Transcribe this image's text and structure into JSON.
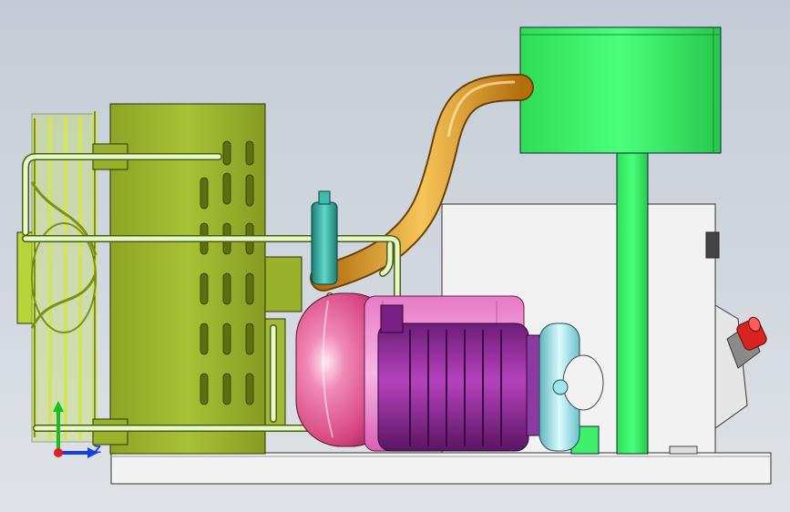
{
  "viewport": {
    "background_top": "#c3ccd6",
    "background_bottom": "#dfe3e7"
  },
  "components": [
    {
      "name": "condenser-fan-guard",
      "color": "#b9d43a"
    },
    {
      "name": "condenser-core",
      "color": "#9ab12c"
    },
    {
      "name": "refrigerant-piping",
      "color": "#e6f7c8"
    },
    {
      "name": "receiver-drier",
      "color": "#2aa79a"
    },
    {
      "name": "discharge-hose",
      "color": "#e0a025"
    },
    {
      "name": "hydraulic-tank",
      "color": "#e56ea0"
    },
    {
      "name": "compressor",
      "color": "#9a2aa0"
    },
    {
      "name": "electric-motor",
      "color": "#ee8fd0"
    },
    {
      "name": "clutch-pulley",
      "color": "#9ee6ea"
    },
    {
      "name": "electrical-cabinet",
      "color": "#f2f2f2"
    },
    {
      "name": "support-frame",
      "color": "#3ef06a"
    },
    {
      "name": "evaporator-box",
      "color": "#3ef06a"
    },
    {
      "name": "emergency-stop",
      "color": "#d92222"
    },
    {
      "name": "base-plate",
      "color": "#f3f3f3"
    }
  ],
  "triad": {
    "y_axis_color": "#18c018",
    "z_axis_color": "#1a3fe0",
    "x_axis_color": "#e02020",
    "z_label": "Z"
  }
}
